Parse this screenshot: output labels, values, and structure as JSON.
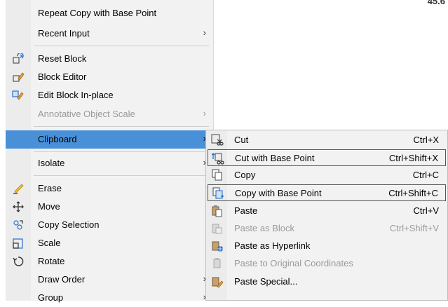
{
  "corner_text": "45.6",
  "context_menu": {
    "items": [
      {
        "label": "Repeat Copy with Base Point",
        "icon": "none",
        "submenu": false,
        "disabled": false
      },
      {
        "label": "Recent Input",
        "icon": "none",
        "submenu": true,
        "disabled": false
      },
      {
        "label": "Reset Block",
        "icon": "reset-block-icon",
        "submenu": false,
        "disabled": false
      },
      {
        "label": "Block Editor",
        "icon": "block-editor-icon",
        "submenu": false,
        "disabled": false
      },
      {
        "label": "Edit Block In-place",
        "icon": "edit-block-inplace-icon",
        "submenu": false,
        "disabled": false
      },
      {
        "label": "Annotative Object Scale",
        "icon": "none",
        "submenu": true,
        "disabled": true
      },
      {
        "label": "Clipboard",
        "icon": "none",
        "submenu": true,
        "disabled": false,
        "highlighted": true
      },
      {
        "label": "Isolate",
        "icon": "none",
        "submenu": true,
        "disabled": false
      },
      {
        "label": "Erase",
        "icon": "eraser-icon",
        "submenu": false,
        "disabled": false
      },
      {
        "label": "Move",
        "icon": "move-icon",
        "submenu": false,
        "disabled": false
      },
      {
        "label": "Copy Selection",
        "icon": "copy-selection-icon",
        "submenu": false,
        "disabled": false
      },
      {
        "label": "Scale",
        "icon": "scale-icon",
        "submenu": false,
        "disabled": false
      },
      {
        "label": "Rotate",
        "icon": "rotate-icon",
        "submenu": false,
        "disabled": false
      },
      {
        "label": "Draw Order",
        "icon": "none",
        "submenu": true,
        "disabled": false
      },
      {
        "label": "Group",
        "icon": "none",
        "submenu": true,
        "disabled": false
      }
    ],
    "submenu_arrow": "›"
  },
  "clipboard_submenu": {
    "items": [
      {
        "label": "Cut",
        "shortcut": "Ctrl+X",
        "icon": "cut-icon",
        "disabled": false
      },
      {
        "label": "Cut with Base Point",
        "shortcut": "Ctrl+Shift+X",
        "icon": "cut-base-point-icon",
        "disabled": false,
        "boxed": true
      },
      {
        "label": "Copy",
        "shortcut": "Ctrl+C",
        "icon": "copy-icon",
        "disabled": false
      },
      {
        "label": "Copy with Base Point",
        "shortcut": "Ctrl+Shift+C",
        "icon": "copy-base-point-icon",
        "disabled": false,
        "boxed": true
      },
      {
        "label": "Paste",
        "shortcut": "Ctrl+V",
        "icon": "paste-icon",
        "disabled": false
      },
      {
        "label": "Paste as Block",
        "shortcut": "Ctrl+Shift+V",
        "icon": "paste-block-icon",
        "disabled": true
      },
      {
        "label": "Paste as Hyperlink",
        "shortcut": "",
        "icon": "paste-hyperlink-icon",
        "disabled": false
      },
      {
        "label": "Paste to Original Coordinates",
        "shortcut": "",
        "icon": "paste-original-coords-icon",
        "disabled": true
      },
      {
        "label": "Paste Special...",
        "shortcut": "",
        "icon": "paste-special-icon",
        "disabled": false
      }
    ]
  },
  "colors": {
    "highlight": "#4a90d9",
    "menu_bg": "#f2f2f2",
    "disabled_text": "#9a9a9a"
  }
}
